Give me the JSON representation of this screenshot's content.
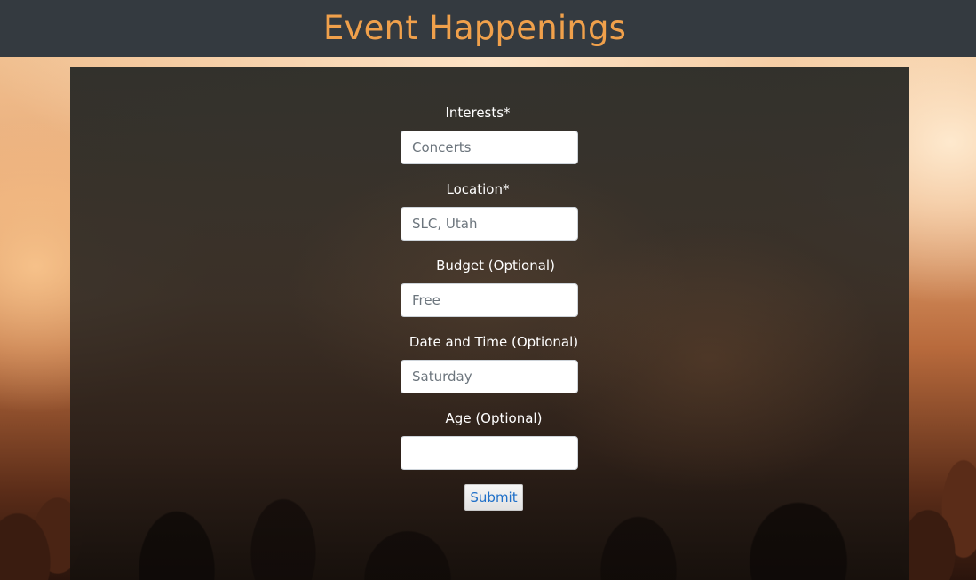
{
  "header": {
    "title": "Event Happenings"
  },
  "form": {
    "fields": [
      {
        "label": "Interests*",
        "placeholder": "Concerts",
        "value": ""
      },
      {
        "label": "Location*",
        "placeholder": "SLC, Utah",
        "value": ""
      },
      {
        "label": "Budget (Optional)",
        "placeholder": "Free",
        "value": ""
      },
      {
        "label": "Date and Time (Optional)",
        "placeholder": "Saturday",
        "value": ""
      },
      {
        "label": "Age (Optional)",
        "placeholder": "",
        "value": ""
      }
    ],
    "submit_label": "Submit"
  },
  "colors": {
    "header_background": "#343a40",
    "title_color": "#f0a04b",
    "submit_text": "#1e6fc8"
  }
}
